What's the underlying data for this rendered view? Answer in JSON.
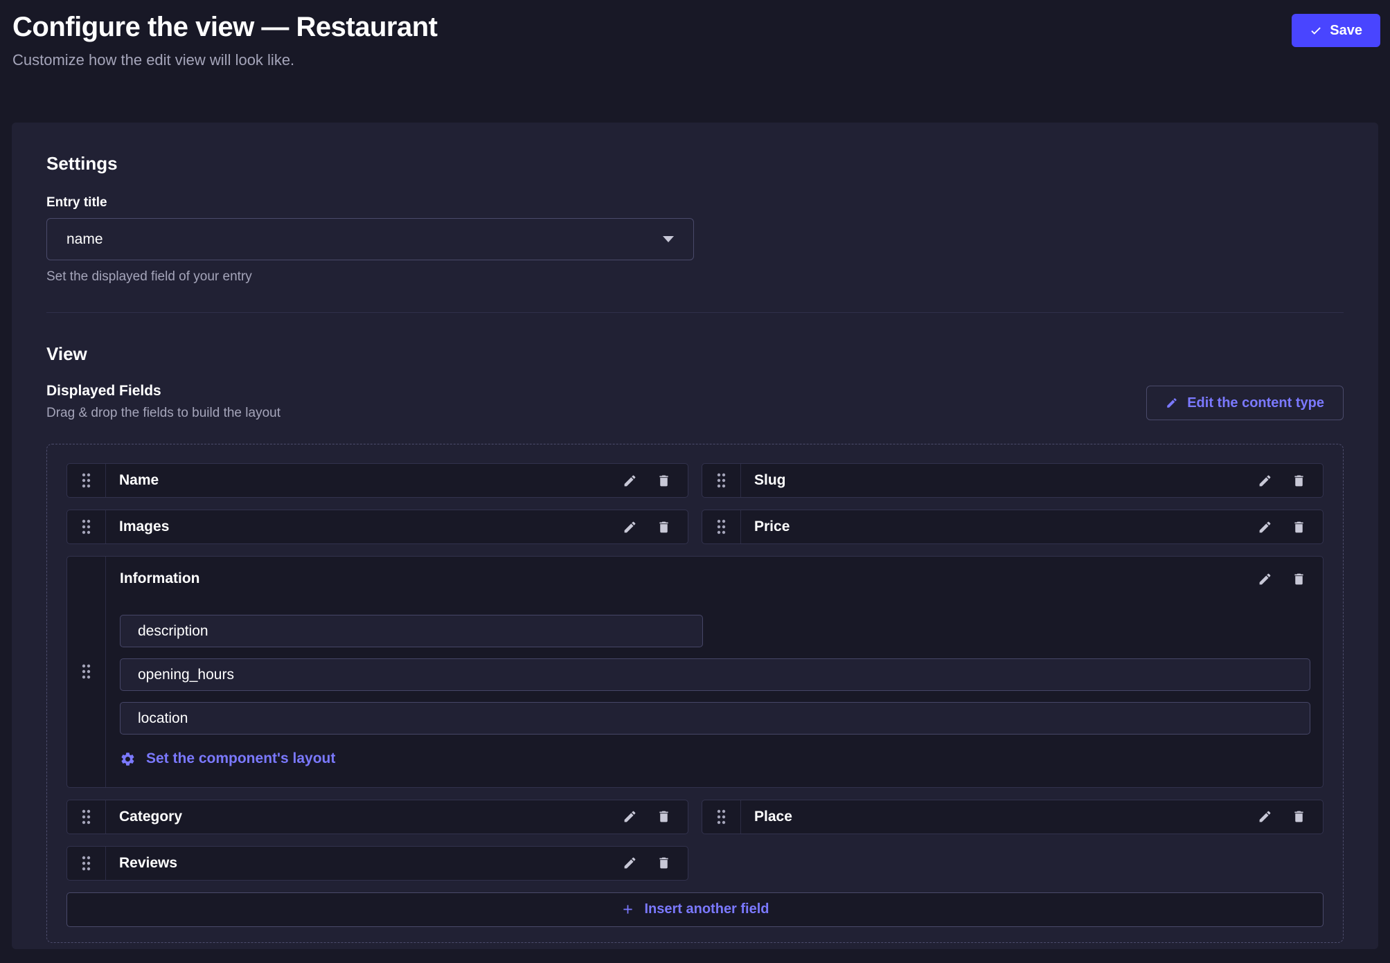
{
  "header": {
    "title": "Configure the view — Restaurant",
    "subtitle": "Customize how the edit view will look like.",
    "save_label": "Save"
  },
  "settings": {
    "heading": "Settings",
    "entry_title": {
      "label": "Entry title",
      "value": "name",
      "hint": "Set the displayed field of your entry"
    }
  },
  "view": {
    "heading": "View",
    "displayed_fields_title": "Displayed Fields",
    "displayed_fields_hint": "Drag & drop the fields to build the layout",
    "edit_content_type_label": "Edit the content type",
    "insert_field_label": "Insert another field"
  },
  "fields": {
    "items": [
      {
        "label": "Name"
      },
      {
        "label": "Slug"
      },
      {
        "label": "Images"
      },
      {
        "label": "Price"
      },
      {
        "label": "Category"
      },
      {
        "label": "Place"
      },
      {
        "label": "Reviews"
      }
    ]
  },
  "component": {
    "title": "Information",
    "fields": [
      "description",
      "opening_hours",
      "location"
    ],
    "layout_link_label": "Set the component's layout"
  },
  "icons": {
    "save": "check-icon",
    "edit": "pencil-icon",
    "delete": "trash-icon",
    "drag": "drag-handle-icon",
    "layout": "gear-icon",
    "insert": "plus-icon",
    "select": "caret-down-icon"
  },
  "colors": {
    "page_background": "#181826",
    "card_background": "#212134",
    "row_background": "#181826",
    "border_subtle": "#32324d",
    "border_strong": "#4a4a6a",
    "primary": "#4945ff",
    "link": "#7b79ff",
    "text_muted": "#a5a5ba"
  }
}
